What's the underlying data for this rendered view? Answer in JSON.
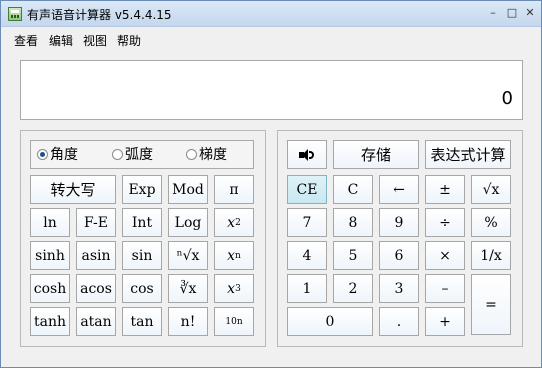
{
  "window": {
    "title": "有声语音计算器 v5.4.4.15",
    "controls": {
      "minimize": "–",
      "maximize": "□",
      "close": "✕"
    }
  },
  "menu": [
    "查看",
    "编辑",
    "视图",
    "帮助"
  ],
  "display": {
    "value": "0"
  },
  "angle_mode": {
    "options": [
      "角度",
      "弧度",
      "梯度"
    ],
    "selected": "角度"
  },
  "left_keys": {
    "convert": "转大写",
    "exp": "Exp",
    "mod": "Mod",
    "pi": "π",
    "ln": "ln",
    "fe": "F-E",
    "int": "Int",
    "log": "Log",
    "x2_base": "x",
    "x2_exp": "2",
    "sinh": "sinh",
    "asin": "asin",
    "sin": "sin",
    "nroot": "ⁿ√x",
    "xn_base": "x",
    "xn_exp": "n",
    "cosh": "cosh",
    "acos": "acos",
    "cos": "cos",
    "cbrt": "∛x",
    "x3_base": "x",
    "x3_exp": "3",
    "tanh": "tanh",
    "atan": "atan",
    "tan": "tan",
    "fact": "n!",
    "tenx_base": "10",
    "tenx_exp": "n"
  },
  "right_keys": {
    "store": "存储",
    "expr": "表达式计算",
    "ce": "CE",
    "c": "C",
    "back": "←",
    "plusminus": "±",
    "sqrt": "√x",
    "d7": "7",
    "d8": "8",
    "d9": "9",
    "div": "÷",
    "pct": "%",
    "d4": "4",
    "d5": "5",
    "d6": "6",
    "mul": "×",
    "recip": "1/x",
    "d1": "1",
    "d2": "2",
    "d3": "3",
    "sub": "–",
    "eq": "=",
    "d0": "0",
    "dot": ".",
    "add": "+"
  },
  "colors": {
    "active_key": "#c8e8f0",
    "radio_dot": "#1d4f91"
  }
}
